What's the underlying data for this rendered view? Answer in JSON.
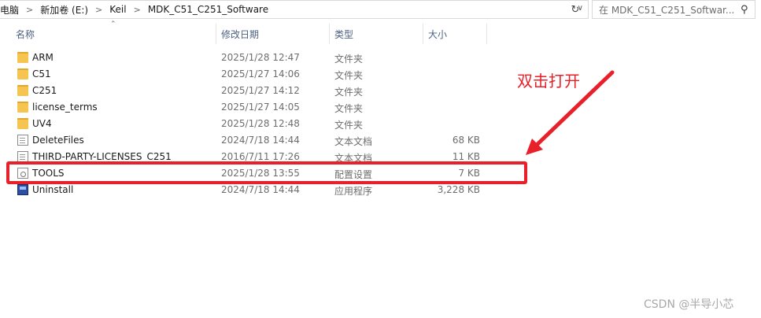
{
  "address": {
    "crumbs": [
      "电脑",
      "新加卷 (E:)",
      "Keil",
      "MDK_C51_C251_Software"
    ]
  },
  "search": {
    "placeholder": "在 MDK_C51_C251_Softwar..."
  },
  "columns": {
    "name": "名称",
    "date": "修改日期",
    "type": "类型",
    "size": "大小"
  },
  "files": [
    {
      "name": "ARM",
      "date": "2025/1/28 12:47",
      "type": "文件夹",
      "size": "",
      "icon": "folder-icon"
    },
    {
      "name": "C51",
      "date": "2025/1/27 14:06",
      "type": "文件夹",
      "size": "",
      "icon": "folder-icon"
    },
    {
      "name": "C251",
      "date": "2025/1/27 14:12",
      "type": "文件夹",
      "size": "",
      "icon": "folder-icon"
    },
    {
      "name": "license_terms",
      "date": "2025/1/27 14:05",
      "type": "文件夹",
      "size": "",
      "icon": "folder-icon"
    },
    {
      "name": "UV4",
      "date": "2025/1/28 12:48",
      "type": "文件夹",
      "size": "",
      "icon": "folder-icon"
    },
    {
      "name": "DeleteFiles",
      "date": "2024/7/18 14:44",
      "type": "文本文档",
      "size": "68 KB",
      "icon": "text-document-icon"
    },
    {
      "name": "THIRD-PARTY-LICENSES_C251",
      "date": "2016/7/11 17:26",
      "type": "文本文档",
      "size": "11 KB",
      "icon": "text-document-icon"
    },
    {
      "name": "TOOLS",
      "date": "2025/1/28 13:55",
      "type": "配置设置",
      "size": "7 KB",
      "icon": "config-file-icon"
    },
    {
      "name": "Uninstall",
      "date": "2024/7/18 14:44",
      "type": "应用程序",
      "size": "3,228 KB",
      "icon": "application-icon"
    }
  ],
  "annotation": {
    "text": "双击打开",
    "color": "#e8202a"
  },
  "watermark": "CSDN @半导小芯"
}
